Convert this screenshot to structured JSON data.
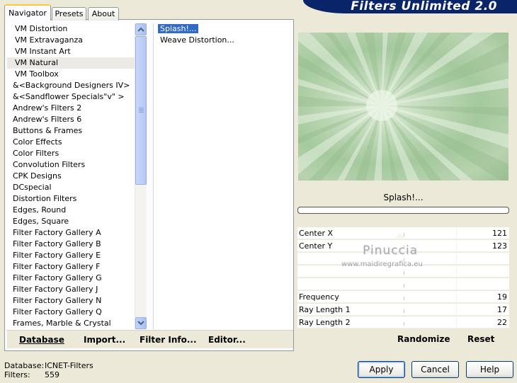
{
  "tabs": [
    "Navigator",
    "Presets",
    "About"
  ],
  "banner_title": "Filters Unlimited 2.0",
  "categories": [
    "VM Distortion",
    "VM Extravaganza",
    "VM Instant Art",
    "VM Natural",
    "VM Toolbox",
    "&<Background Designers IV>",
    "&<Sandflower Specials\"v\" >",
    "Andrew's Filters 2",
    "Andrew's Filters 6",
    "Buttons & Frames",
    "Color Effects",
    "Color Filters",
    "Convolution Filters",
    "CPK Designs",
    "DCspecial",
    "Distortion Filters",
    "Edges, Round",
    "Edges, Square",
    "Filter Factory Gallery A",
    "Filter Factory Gallery B",
    "Filter Factory Gallery E",
    "Filter Factory Gallery F",
    "Filter Factory Gallery G",
    "Filter Factory Gallery J",
    "Filter Factory Gallery N",
    "Filter Factory Gallery Q",
    "Frames, Marble & Crystal"
  ],
  "selected_category": "VM Natural",
  "filters": [
    "Splash!...",
    "Weave Distortion..."
  ],
  "selected_filter": "Splash!...",
  "left_toolbar": {
    "database": "Database",
    "import": "Import...",
    "filter_info": "Filter Info...",
    "editor": "Editor..."
  },
  "preview_filter_name": "Splash!...",
  "params": [
    {
      "label": "Center X",
      "value": "121"
    },
    {
      "label": "Center Y",
      "value": "123"
    },
    {
      "label": "",
      "value": ""
    },
    {
      "label": "",
      "value": ""
    },
    {
      "label": "",
      "value": ""
    },
    {
      "label": "Frequency",
      "value": "19"
    },
    {
      "label": "Ray Length 1",
      "value": "17"
    },
    {
      "label": "Ray Length 2",
      "value": "22"
    }
  ],
  "watermark": {
    "name": "Pinuccia",
    "site": "www.maidiregrafica.eu"
  },
  "right_toolbar": {
    "randomize": "Randomize",
    "reset": "Reset"
  },
  "status": {
    "database_label": "Database:",
    "database_value": "ICNET-Filters",
    "filters_label": "Filters:",
    "filters_value": "559"
  },
  "buttons": {
    "apply": "Apply",
    "cancel": "Cancel",
    "help": "Help"
  },
  "colors": {
    "selection": "#316ac5",
    "banner": "#0a246a",
    "dialog": "#ece9d8"
  }
}
